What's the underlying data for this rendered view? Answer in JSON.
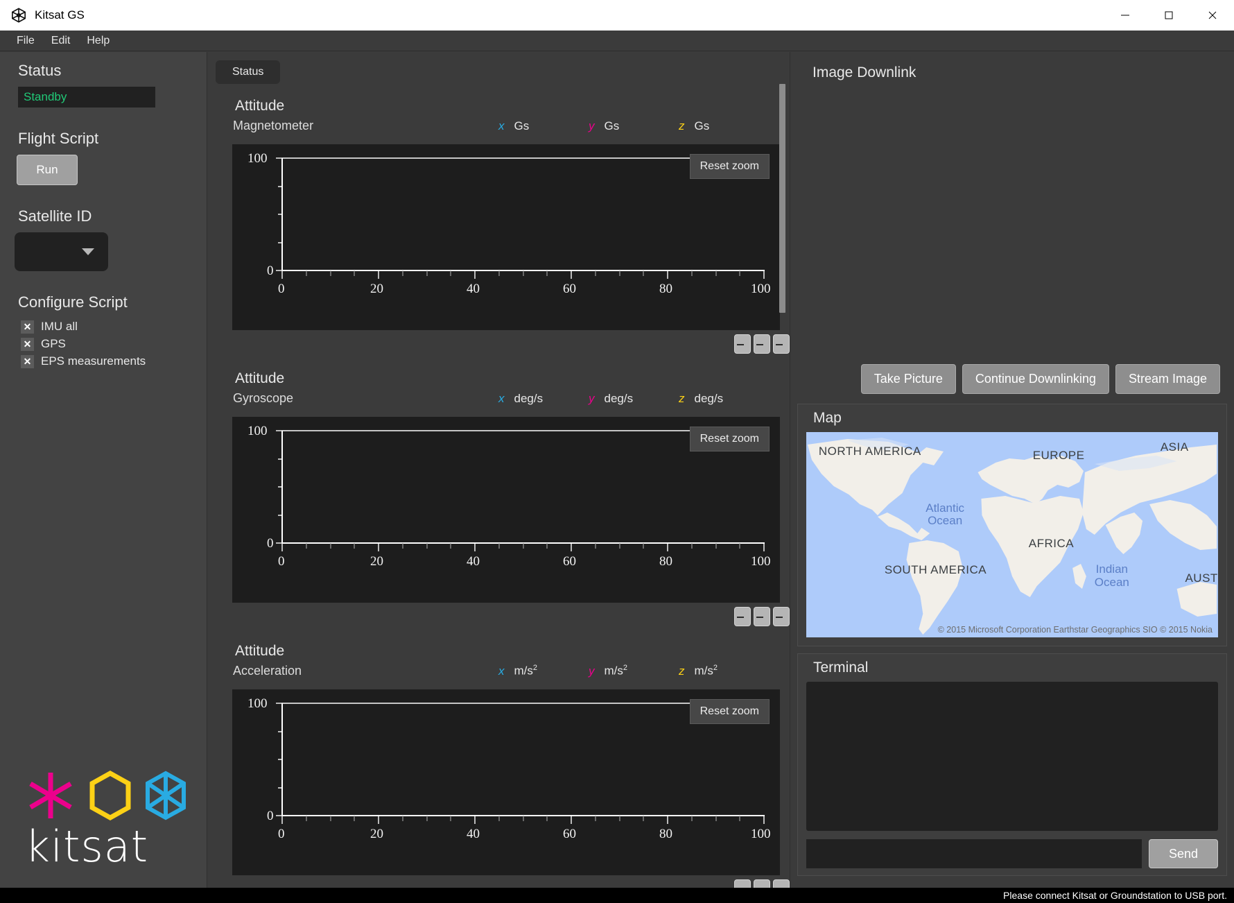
{
  "window": {
    "title": "Kitsat GS",
    "app_icon": "cube-hexagon-icon",
    "minimize": "—",
    "maximize": "☐",
    "close": "✕"
  },
  "menubar": {
    "items": [
      "File",
      "Edit",
      "Help"
    ]
  },
  "sidebar": {
    "status_heading": "Status",
    "status_value": "Standby",
    "status_color": "#21c977",
    "flight_script_heading": "Flight Script",
    "run_label": "Run",
    "satellite_id_heading": "Satellite ID",
    "satellite_id_value": "",
    "configure_heading": "Configure Script",
    "checkboxes": [
      {
        "label": "IMU all",
        "mark": "✕",
        "checked": true
      },
      {
        "label": "GPS",
        "mark": "✕",
        "checked": true
      },
      {
        "label": "EPS measurements",
        "mark": "✕",
        "checked": true
      }
    ],
    "logo_text": "kitsat",
    "logo_colors": {
      "asterisk": "#ec008c",
      "hexagon": "#fcd116",
      "cube": "#29abe2"
    }
  },
  "center": {
    "tab_label": "Status",
    "accent_x": "#29abe2",
    "accent_y": "#ec008c",
    "accent_z": "#fcd116",
    "reset_zoom_label": "Reset zoom",
    "plots": [
      {
        "title": "Attitude",
        "subtitle": "Magnetometer",
        "legend": [
          {
            "axis": "x",
            "unit": "Gs"
          },
          {
            "axis": "y",
            "unit": "Gs"
          },
          {
            "axis": "z",
            "unit": "Gs"
          }
        ]
      },
      {
        "title": "Attitude",
        "subtitle": "Gyroscope",
        "legend": [
          {
            "axis": "x",
            "unit": "deg/s"
          },
          {
            "axis": "y",
            "unit": "deg/s"
          },
          {
            "axis": "z",
            "unit": "deg/s"
          }
        ]
      },
      {
        "title": "Attitude",
        "subtitle": "Acceleration",
        "legend": [
          {
            "axis": "x",
            "unit": "m/s",
            "sup": "2"
          },
          {
            "axis": "y",
            "unit": "m/s",
            "sup": "2"
          },
          {
            "axis": "z",
            "unit": "m/s",
            "sup": "2"
          }
        ]
      }
    ]
  },
  "chart_data": {
    "type": "line",
    "title": "Attitude",
    "xlabel": "",
    "ylabel": "",
    "xlim": [
      0,
      100
    ],
    "ylim": [
      0,
      100
    ],
    "xticks": [
      0,
      20,
      40,
      60,
      80,
      100
    ],
    "yticks": [
      0,
      100
    ],
    "grid": false,
    "series": [
      {
        "name": "x",
        "color": "#29abe2",
        "values": []
      },
      {
        "name": "y",
        "color": "#ec008c",
        "values": []
      },
      {
        "name": "z",
        "color": "#fcd116",
        "values": []
      }
    ]
  },
  "right": {
    "downlink_title": "Image Downlink",
    "downlink_buttons": [
      "Take Picture",
      "Continue Downlinking",
      "Stream Image"
    ],
    "map_title": "Map",
    "map_labels": [
      {
        "text": "NORTH AMERICA",
        "left": 3,
        "top": 6
      },
      {
        "text": "EUROPE",
        "left": 55,
        "top": 8
      },
      {
        "text": "ASIA",
        "left": 86,
        "top": 4
      },
      {
        "text": "AFRICA",
        "left": 54,
        "top": 51
      },
      {
        "text": "SOUTH AMERICA",
        "left": 19,
        "top": 64
      },
      {
        "text": "AUST",
        "left": 92,
        "top": 68
      }
    ],
    "map_oceans": [
      {
        "text": "Atlantic\nOcean",
        "left": 29,
        "top": 34
      },
      {
        "text": "Indian\nOcean",
        "left": 70,
        "top": 64
      }
    ],
    "map_credit": "© 2015 Microsoft Corporation  Earthstar Geographics SIO © 2015 Nokia",
    "terminal_title": "Terminal",
    "terminal_output": "",
    "terminal_input_value": "",
    "terminal_input_placeholder": "",
    "send_label": "Send"
  },
  "statusbar": {
    "message": "Please connect Kitsat or Groundstation to USB port."
  }
}
